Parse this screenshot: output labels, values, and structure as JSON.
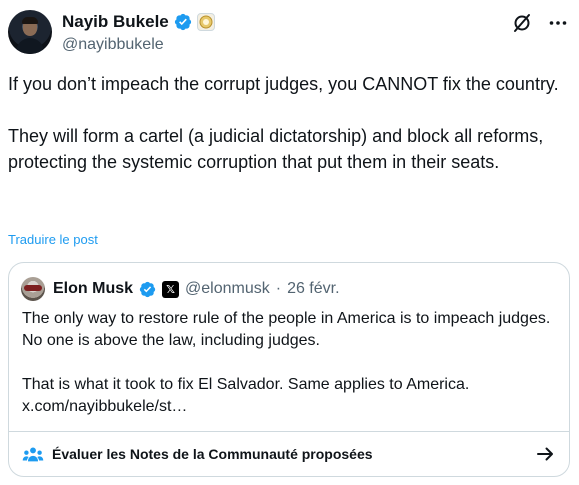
{
  "author": {
    "display_name": "Nayib Bukele",
    "handle": "@nayibbukele"
  },
  "header_icons": [
    "grok-icon",
    "more-icon"
  ],
  "tweet": {
    "text": "If you don’t impeach the corrupt judges, you CANNOT fix the country.\n\nThey will form a cartel (a judicial dictatorship) and block all reforms, protecting the systemic corruption that put them in their seats.",
    "translate_label": "Traduire le post"
  },
  "quoted": {
    "display_name": "Elon Musk",
    "handle": "@elonmusk",
    "separator": "·",
    "date": "26 févr.",
    "text": "The only way to restore rule of the people in America is to impeach judges. No one is above the law, including judges.\n\nThat is what it took to fix El Salvador. Same applies to America.\nx.com/nayibbukele/st…",
    "affiliate_badge": "𝕏"
  },
  "community_notes": {
    "label": "Évaluer les Notes de la Communauté proposées"
  },
  "colors": {
    "verified_blue": "#1d9bf0",
    "secondary_text": "#536471",
    "border": "#cfd9de",
    "link": "#1d9bf0"
  }
}
